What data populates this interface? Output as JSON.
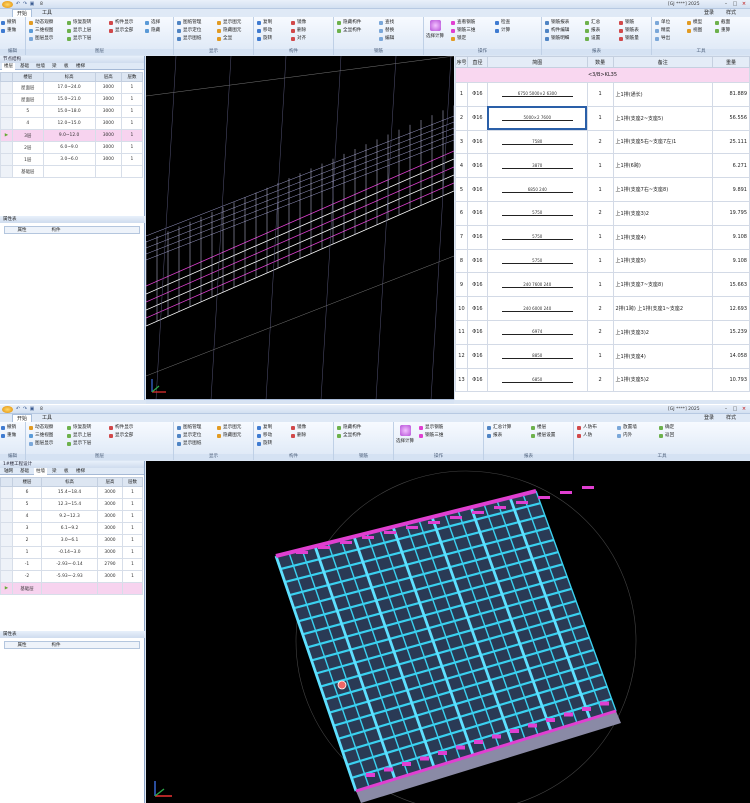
{
  "app": {
    "file_name": "8",
    "window_title": "[GJ ****] 2025",
    "menu_tabs": [
      "开始",
      "工具"
    ],
    "right_menu": [
      "登录",
      "样式",
      "?"
    ]
  },
  "ribbon1": {
    "col1": [
      "撤销",
      "重做"
    ],
    "col2": [
      "动态观察",
      "三维视图",
      "图层显示"
    ],
    "col3": [
      "恢复旋转",
      "显示上层",
      "显示下层"
    ],
    "col4": [
      "构件显示",
      "显示全部"
    ],
    "col5": [
      "选择",
      "隐藏"
    ],
    "col6": [
      "图纸管理",
      "显示定位",
      "显示图纸"
    ],
    "col7": [
      "显示图元",
      "隐藏图元",
      "全显"
    ],
    "col8": [
      "复制",
      "移动",
      "旋转"
    ],
    "col9": [
      "镜像",
      "删除",
      "对齐"
    ],
    "col10": [
      "隐藏构件",
      "全显构件"
    ],
    "col11": [
      "查找",
      "替换",
      "编辑"
    ],
    "big1": "构件显示",
    "big2": "选择计算",
    "col12": [
      "查看钢筋",
      "钢筋三维",
      "锁定"
    ],
    "col13": [
      "检查",
      "计算"
    ],
    "col14": [
      "钢筋报表",
      "构件编辑",
      "钢筋明细"
    ],
    "col15": [
      "汇总",
      "报表",
      "设置"
    ],
    "col16": [
      "钢筋",
      "钢筋表",
      "钢筋量"
    ],
    "col17": [
      "单位",
      "精度",
      "导出"
    ],
    "col18": [
      "模型",
      "视图",
      "导出"
    ],
    "col19": [
      "截面",
      "重算"
    ],
    "col20": [
      "设置"
    ],
    "groups": [
      "编辑",
      "图层",
      "显示",
      "构件",
      "钢筋",
      "操作",
      "报表",
      "工具"
    ]
  },
  "floors1": {
    "title": "节点结构",
    "tabs": [
      "楼层",
      "基础",
      "柱墙",
      "梁",
      "板",
      "楼梯"
    ],
    "headers": [
      "楼层",
      "标高",
      "层高",
      "层数"
    ],
    "rows": [
      [
        "屋面层",
        "17.0~24.0",
        "3000",
        "1"
      ],
      [
        "屋面层",
        "15.0~21.0",
        "3000",
        "1"
      ],
      [
        "5",
        "15.0~18.0",
        "3000",
        "1"
      ],
      [
        "4",
        "12.0~15.0",
        "3000",
        "1"
      ],
      [
        "3层",
        "9.0~12.0",
        "3000",
        "1"
      ],
      [
        "2层",
        "6.0~9.0",
        "3000",
        "1"
      ],
      [
        "1层",
        "3.0~6.0",
        "3000",
        "1"
      ],
      [
        "基础层",
        "",
        "",
        ""
      ]
    ],
    "selected_row": 4
  },
  "props1": {
    "title": "属性表",
    "tabs": [
      "属性",
      "构件"
    ]
  },
  "rebar_table": {
    "headers": [
      "序号",
      "直径",
      "简图",
      "数量",
      "备注",
      "重量"
    ],
    "beam_label": "<3/B>KL35",
    "rows": [
      [
        "1",
        "Φ16",
        "6750  5000×2  6300",
        "1",
        "上1排(通长)",
        "81.889"
      ],
      [
        "2",
        "Φ16",
        "5000×2  7600",
        "1",
        "上1排(支座2~支座5)",
        "56.556"
      ],
      [
        "3",
        "Φ16",
        "7580",
        "2",
        "上1排(支座5右~支座7左)1",
        "25.111"
      ],
      [
        "4",
        "Φ16",
        "3870",
        "1",
        "上1排(6跨)",
        "6.271"
      ],
      [
        "5",
        "Φ16",
        "6850  240",
        "1",
        "上1排(支座7右~支座8)",
        "9.891"
      ],
      [
        "6",
        "Φ16",
        "5750",
        "2",
        "上1排(支座3)2",
        "19.795"
      ],
      [
        "7",
        "Φ16",
        "5750",
        "1",
        "上1排(支座4)",
        "9.108"
      ],
      [
        "8",
        "Φ16",
        "5750",
        "1",
        "上1排(支座5)",
        "9.108"
      ],
      [
        "9",
        "Φ16",
        "240  7600  240",
        "1",
        "上1排(支座7~支座8)",
        "15.663"
      ],
      [
        "10",
        "Φ16",
        "240  6000  240",
        "2",
        "2排(1跨) 上1排(支座1~支座2",
        "12.693"
      ],
      [
        "11",
        "Φ16",
        "6974",
        "2",
        "上1排(支座3)2",
        "15.239"
      ],
      [
        "12",
        "Φ16",
        "8850",
        "1",
        "上1排(支座4)",
        "14.058"
      ],
      [
        "13",
        "Φ16",
        "6850",
        "2",
        "上1排(支座5)2",
        "10.793"
      ]
    ]
  },
  "floors2": {
    "title": "1#楼工程设计",
    "tabs": [
      "轴网",
      "基础",
      "柱墙",
      "梁",
      "板",
      "楼梯"
    ],
    "headers": [
      "楼层",
      "标高",
      "层高",
      "层数"
    ],
    "rows": [
      [
        "6",
        "15.4~18.4",
        "3000",
        "1"
      ],
      [
        "5",
        "12.3~15.4",
        "3000",
        "1"
      ],
      [
        "4",
        "9.2~12.3",
        "3000",
        "1"
      ],
      [
        "3",
        "6.1~9.2",
        "3000",
        "1"
      ],
      [
        "2",
        "3.0~6.1",
        "3000",
        "1"
      ],
      [
        "1",
        "-0.14~3.0",
        "3000",
        "1"
      ],
      [
        "-1",
        "-2.93~-0.14",
        "2790",
        "1"
      ],
      [
        "-2",
        "-5.93~-2.93",
        "3000",
        "1"
      ],
      [
        "基础层",
        "",
        "",
        ""
      ]
    ],
    "selected_row": 8
  },
  "props2": {
    "title": "属性表",
    "tabs": [
      "属性",
      "构件"
    ]
  },
  "ribbon2": {
    "colA": [
      "显示钢筋",
      "钢筋三维"
    ],
    "colB": [
      "设置",
      "构件"
    ],
    "colC": [
      "楼层",
      "楼层设置"
    ],
    "colD": [
      "汇总计算",
      "报表"
    ],
    "colE": [
      "插件",
      "工具"
    ],
    "colF": [
      "人防布",
      "人防"
    ],
    "colG": [
      "放置墙",
      "内外"
    ],
    "colH": [
      "确定",
      "返回"
    ]
  },
  "colors": {
    "selection": "#f7d3ef",
    "viewport": "#000000",
    "rebar_magenta": "#e03fd1",
    "building_cyan": "#3ad1f0",
    "ribbon": "#dde8f6"
  }
}
